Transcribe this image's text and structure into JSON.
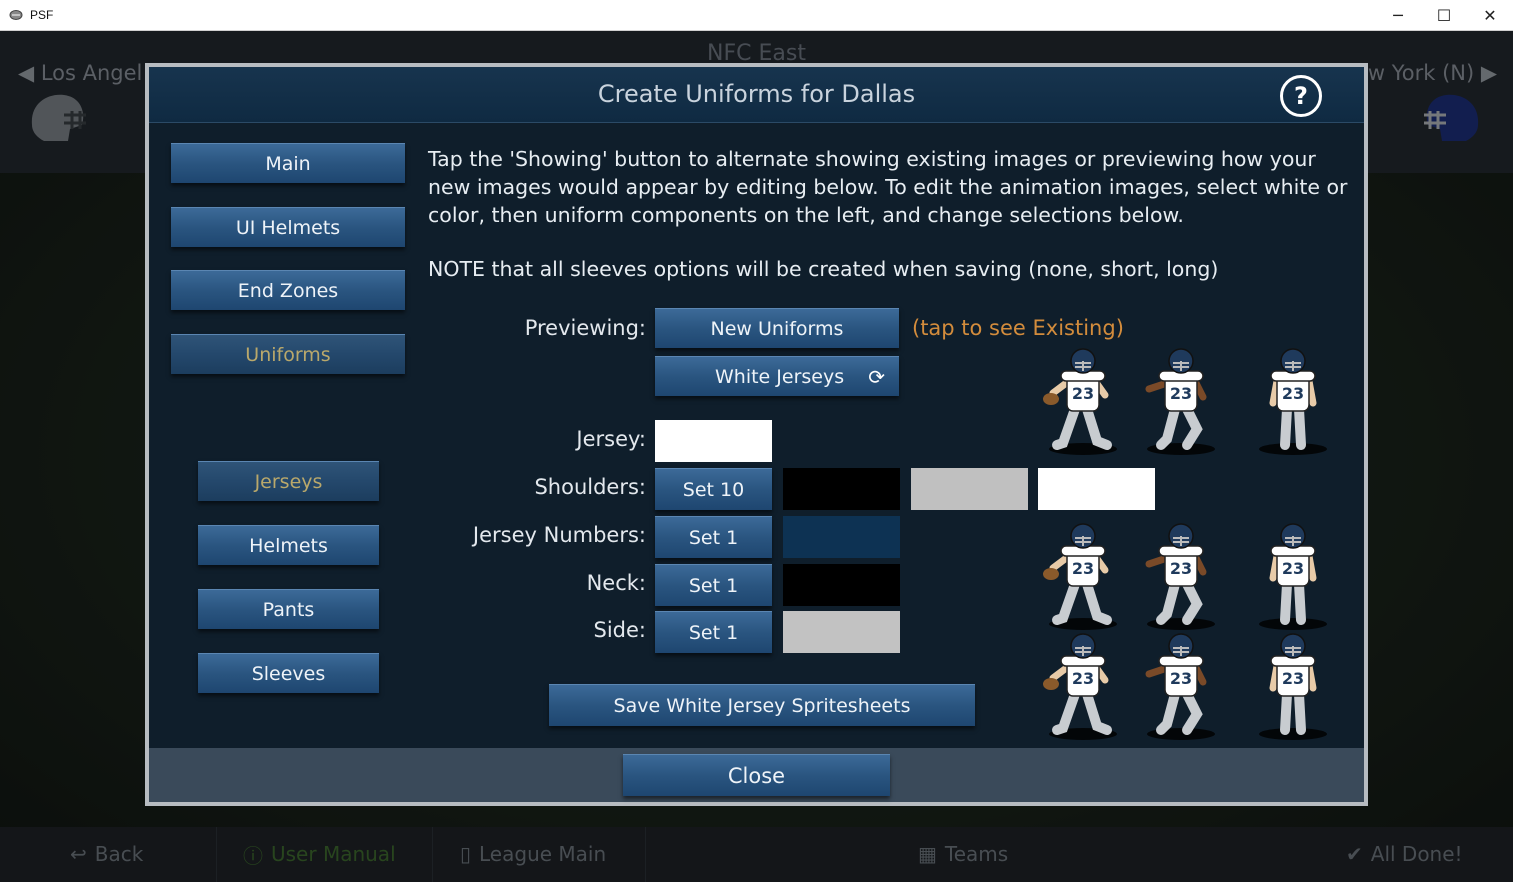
{
  "window": {
    "title": "PSF",
    "minimize": "─",
    "maximize": "☐",
    "close": "✕"
  },
  "background": {
    "division": "NFC East",
    "prev_team": "Los Angel",
    "next_team": "w York (N)",
    "footer": {
      "back": "Back",
      "user_manual": "User Manual",
      "league_main": "League Main",
      "teams": "Teams",
      "all_done": "All Done!"
    }
  },
  "dialog": {
    "title": "Create Uniforms for Dallas",
    "help_label": "?",
    "nav": {
      "main": "Main",
      "ui_helmets": "UI Helmets",
      "end_zones": "End Zones",
      "uniforms": "Uniforms"
    },
    "components": {
      "jerseys": "Jerseys",
      "helmets": "Helmets",
      "pants": "Pants",
      "sleeves": "Sleeves"
    },
    "description": "Tap the 'Showing' button to alternate showing existing images or previewing how your new images would appear by editing below.  To edit the animation images, select white or color, then uniform components on the left, and change selections below.",
    "note": "NOTE that all sleeves options will be created when saving (none, short, long)",
    "previewing_label": "Previewing:",
    "previewing_button": "New Uniforms",
    "previewing_hint": "(tap to see Existing)",
    "jersey_set_button": "White Jerseys",
    "rows": {
      "jersey": {
        "label": "Jersey:",
        "color": "#ffffff"
      },
      "shoulders": {
        "label": "Shoulders:",
        "set": "Set 10",
        "colors": [
          "#000000",
          "#c0c0c0",
          "#ffffff"
        ]
      },
      "numbers": {
        "label": "Jersey Numbers:",
        "set": "Set 1",
        "color": "#0d3253"
      },
      "neck": {
        "label": "Neck:",
        "set": "Set 1",
        "color": "#000000"
      },
      "side": {
        "label": "Side:",
        "set": "Set 1",
        "color": "#c2c2c2"
      }
    },
    "save_button": "Save White Jersey Spritesheets",
    "close_button": "Close",
    "sprite_number": "23"
  },
  "colors": {
    "accent_orange": "#d38c3c",
    "selected_gold": "#b9a86b",
    "helmet_navy": "#1f3a5c",
    "pants_silver": "#c8ccd0"
  }
}
